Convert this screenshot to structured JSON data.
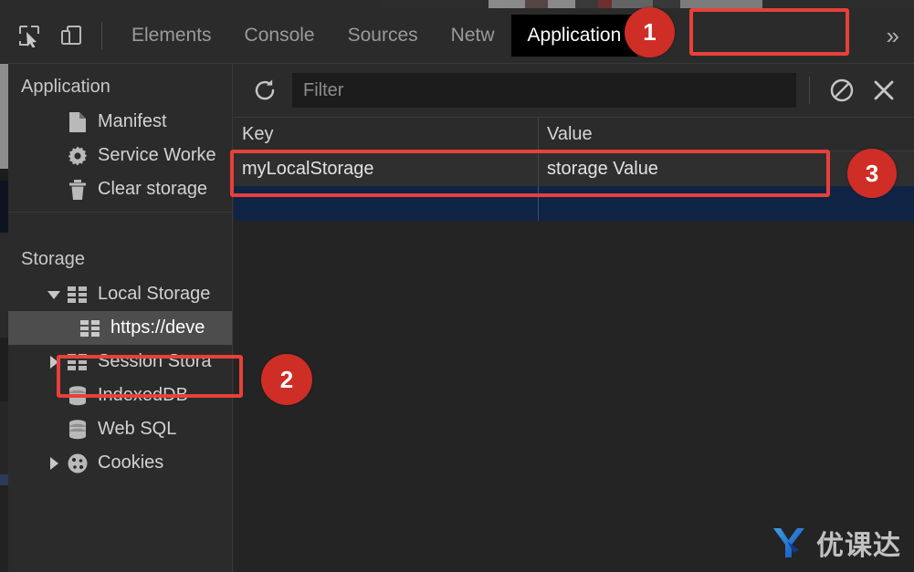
{
  "colors": {
    "accent_red": "#cf2e26",
    "highlight_border": "#e8403a",
    "panel_bg": "#2b2b2b",
    "table_bg": "#242424",
    "selected_row_blue": "#0f2444",
    "selected_tree_gray": "#4d4d4d",
    "tab_selected_bg": "#000000",
    "logo_blue": "#1e7fe0"
  },
  "tabbar": {
    "tools": [
      {
        "name": "inspect-element-icon",
        "label": "Inspect element"
      },
      {
        "name": "device-toolbar-icon",
        "label": "Toggle device toolbar"
      }
    ],
    "tabs": [
      {
        "label": "Elements",
        "selected": false
      },
      {
        "label": "Console",
        "selected": false
      },
      {
        "label": "Sources",
        "selected": false
      },
      {
        "label": "Netw",
        "selected": false
      },
      {
        "label": "Application",
        "selected": true
      }
    ],
    "overflow": "»"
  },
  "sidebar": {
    "application": {
      "title": "Application",
      "items": [
        {
          "label": "Manifest",
          "icon": "document-icon",
          "twisty": "none"
        },
        {
          "label": "Service Worke",
          "icon": "gear-icon",
          "twisty": "none"
        },
        {
          "label": "Clear storage",
          "icon": "trash-icon",
          "twisty": "none"
        }
      ]
    },
    "storage": {
      "title": "Storage",
      "items": [
        {
          "label": "Local Storage",
          "icon": "table-icon",
          "twisty": "open",
          "indent": 1,
          "selected": false
        },
        {
          "label": "https://deve",
          "icon": "table-icon",
          "twisty": "none",
          "indent": 2,
          "selected": true
        },
        {
          "label": "Session Stora",
          "icon": "table-icon",
          "twisty": "closed",
          "indent": 1,
          "selected": false
        },
        {
          "label": "IndexedDB",
          "icon": "database-icon",
          "twisty": "none",
          "indent": 1,
          "selected": false
        },
        {
          "label": "Web SQL",
          "icon": "database-icon",
          "twisty": "none",
          "indent": 1,
          "selected": false
        },
        {
          "label": "Cookies",
          "icon": "cookie-icon",
          "twisty": "closed",
          "indent": 1,
          "selected": false
        }
      ]
    }
  },
  "pane": {
    "toolbar": {
      "refresh": {
        "name": "refresh-icon",
        "label": "Refresh"
      },
      "filter": {
        "placeholder": "Filter",
        "value": ""
      },
      "clear_all": {
        "name": "no-entry-icon",
        "label": "Clear all"
      },
      "delete_selected": {
        "name": "close-x-icon",
        "label": "Delete selected"
      }
    },
    "table": {
      "columns": [
        "Key",
        "Value"
      ],
      "rows": [
        {
          "key": "myLocalStorage",
          "value": "storage Value",
          "selected": false
        },
        {
          "key": "",
          "value": "",
          "selected": true
        }
      ]
    }
  },
  "callouts": [
    {
      "number": "1",
      "target": "application-tab"
    },
    {
      "number": "2",
      "target": "local-storage-origin-item"
    },
    {
      "number": "3",
      "target": "storage-row"
    }
  ],
  "watermark": {
    "logo": "Y",
    "text": "优课达"
  }
}
